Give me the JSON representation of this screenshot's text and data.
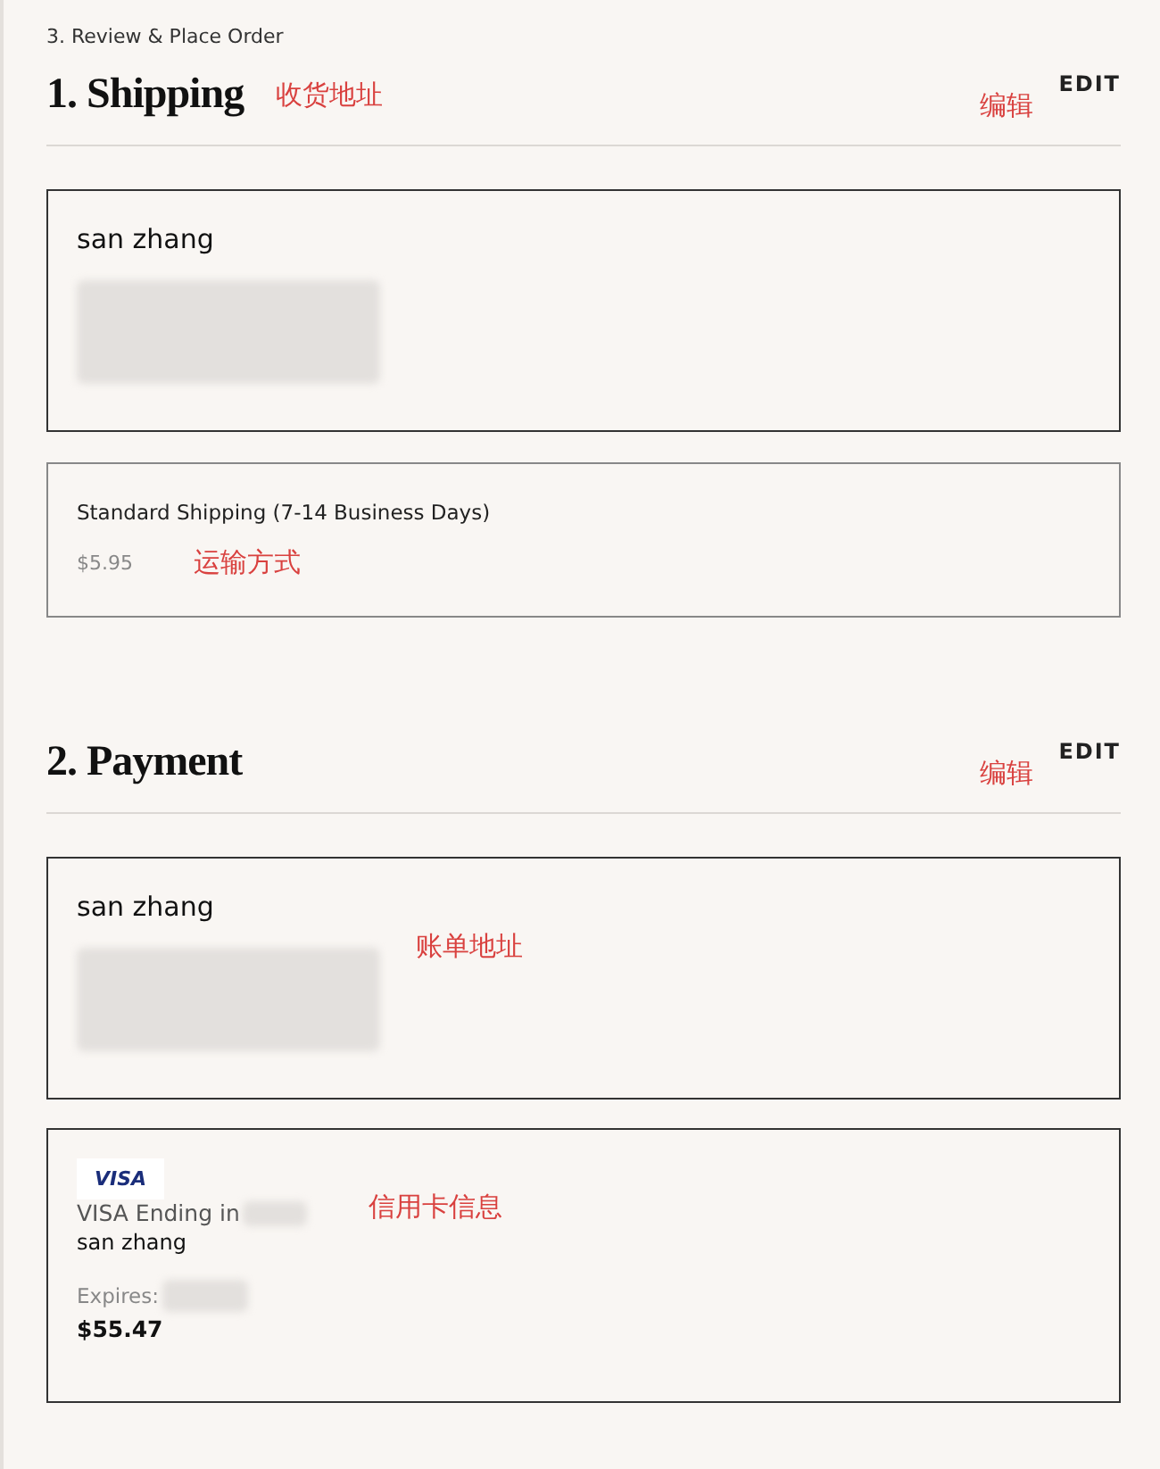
{
  "step_label": "3. Review & Place Order",
  "shipping": {
    "title": "1. Shipping",
    "annotation": "收货地址",
    "edit_annotation": "编辑",
    "edit": "EDIT",
    "address": {
      "name": "san zhang"
    },
    "method": {
      "name": "Standard Shipping (7-14 Business Days)",
      "price": "$5.95",
      "annotation": "运输方式"
    }
  },
  "payment": {
    "title": "2. Payment",
    "edit_annotation": "编辑",
    "edit": "EDIT",
    "address": {
      "name": "san zhang",
      "annotation": "账单地址"
    },
    "card": {
      "logo": "VISA",
      "ending": "VISA Ending in",
      "annotation": "信用卡信息",
      "holder": "san zhang",
      "expires": "Expires:",
      "amount": "$55.47"
    }
  }
}
